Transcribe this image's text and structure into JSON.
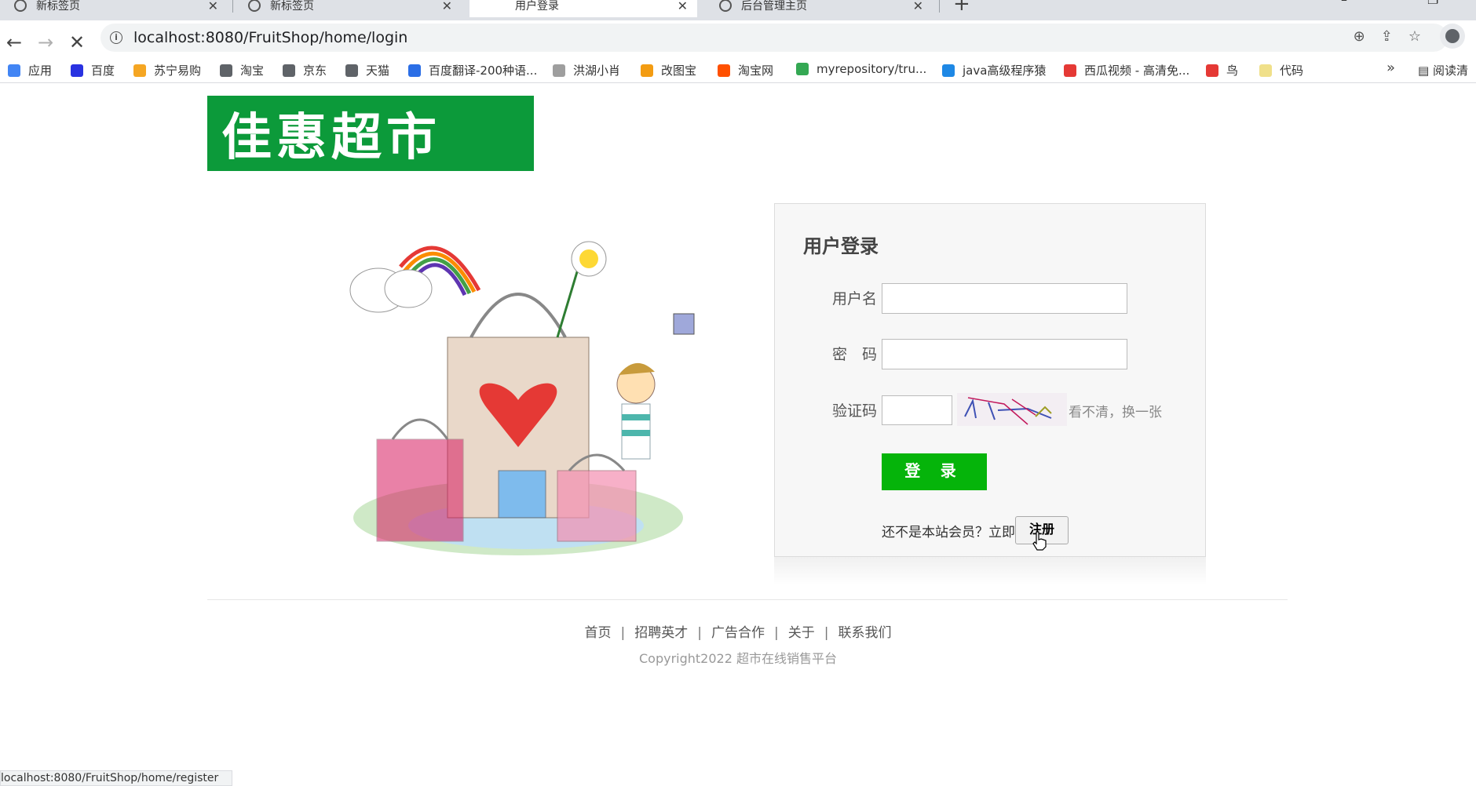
{
  "browser": {
    "tabs": [
      {
        "title": "新标签页"
      },
      {
        "title": "新标签页"
      },
      {
        "title": "用户登录"
      },
      {
        "title": "后台管理主页"
      }
    ],
    "url_host": "localhost",
    "url_rest": ":8080/FruitShop/home/login",
    "bookmarks": [
      {
        "label": "应用",
        "color": "#4285f4"
      },
      {
        "label": "百度",
        "color": "#2932e1"
      },
      {
        "label": "苏宁易购",
        "color": "#f5a623"
      },
      {
        "label": "淘宝",
        "color": "#5f6368"
      },
      {
        "label": "京东",
        "color": "#5f6368"
      },
      {
        "label": "天猫",
        "color": "#5f6368"
      },
      {
        "label": "百度翻译-200种语...",
        "color": "#2b6ee6"
      },
      {
        "label": "洪湖小肖",
        "color": "#9e9e9e"
      },
      {
        "label": "改图宝",
        "color": "#f39c12"
      },
      {
        "label": "淘宝网",
        "color": "#ff5000"
      },
      {
        "label": "myrepository/tru...",
        "color": "#34a853"
      },
      {
        "label": "java高级程序猿",
        "color": "#1e88e5"
      },
      {
        "label": "西瓜视频 - 高清免...",
        "color": "#e53935"
      },
      {
        "label": "鸟",
        "color": "#e53935"
      },
      {
        "label": "代码",
        "color": "#f0e08a"
      }
    ],
    "reader_label": "阅读清",
    "status_url": "localhost:8080/FruitShop/home/register"
  },
  "page": {
    "logo_text": "佳惠超市",
    "login": {
      "title": "用户登录",
      "username_label": "用户名",
      "password_label": "密　码",
      "captcha_label": "验证码",
      "captcha_refresh": "看不清，换一张",
      "submit_label": "登 录",
      "register_hint": "还不是本站会员？立即",
      "register_label": "注册"
    },
    "footer": {
      "links": [
        "首页",
        "招聘英才",
        "广告合作",
        "关于",
        "联系我们"
      ],
      "copyright": "Copyright2022 超市在线销售平台"
    }
  },
  "colors": {
    "brand_green": "#0c9a3a",
    "button_green": "#05b40a"
  }
}
